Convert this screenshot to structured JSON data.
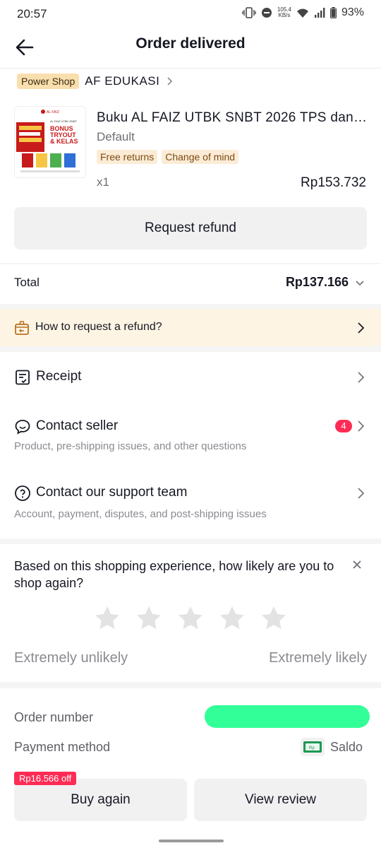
{
  "status_bar": {
    "time": "20:57",
    "net_speed_value": "105.4",
    "net_speed_unit": "KB/s",
    "battery": "93%"
  },
  "header": {
    "title": "Order delivered"
  },
  "shop": {
    "badge": "Power Shop",
    "name": "AF EDUKASI"
  },
  "product": {
    "title": "Buku AL FAIZ UTBK SNBT 2026 TPS dan L...",
    "variant": "Default",
    "tags": [
      "Free returns",
      "Change of mind"
    ],
    "quantity": "x1",
    "price": "Rp153.732",
    "thumb_text": {
      "brand": "AL FAIZ",
      "subtitle": "AL FAIZ UTBK-SNBT",
      "headline_1": "BONUS",
      "headline_2": "TRYOUT",
      "headline_3": "& KELAS"
    }
  },
  "actions": {
    "request_refund": "Request refund"
  },
  "total": {
    "label": "Total",
    "value": "Rp137.166"
  },
  "refund_help": {
    "text": "How to request a refund?"
  },
  "rows": {
    "receipt": {
      "title": "Receipt"
    },
    "contact_seller": {
      "title": "Contact seller",
      "subtitle": "Product, pre-shipping issues, and other questions",
      "badge": "4"
    },
    "support": {
      "title": "Contact our support team",
      "subtitle": "Account, payment, disputes, and post-shipping issues"
    }
  },
  "survey": {
    "question": "Based on this shopping experience, how likely are you to shop again?",
    "star_count": 5,
    "selected_stars": 0,
    "low_label": "Extremely unlikely",
    "high_label": "Extremely likely"
  },
  "order_info": {
    "order_number_label": "Order number",
    "payment_label": "Payment method",
    "payment_value": "Saldo",
    "payment_icon_text": "Rp"
  },
  "bottom": {
    "discount_tag": "Rp16.566 off",
    "buy_again": "Buy again",
    "view_review": "View review"
  },
  "colors": {
    "accent_red": "#fe2c55",
    "banner_bg": "#fef4e4",
    "tag_bg": "#fcecd6",
    "power_badge_bg": "#f9dfae",
    "redaction": "#33ff99"
  }
}
